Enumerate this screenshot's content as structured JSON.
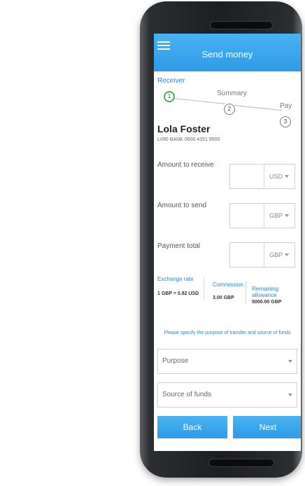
{
  "header": {
    "title": "Send money"
  },
  "steps": [
    {
      "label": "Receiver",
      "number": "1"
    },
    {
      "label": "Summary",
      "number": "2"
    },
    {
      "label": "Pay",
      "number": "3"
    }
  ],
  "receiver": {
    "name": "Lola Foster",
    "account": "LV80 BANK 0000 4351 9500"
  },
  "fields": [
    {
      "label": "Amount to receive",
      "value": "",
      "currency": "USD"
    },
    {
      "label": "Amount to send",
      "value": "",
      "currency": "GBP"
    },
    {
      "label": "Payment total",
      "value": "",
      "currency": "GBP"
    }
  ],
  "stats": {
    "exchange_rate": {
      "label": "Exchange rate",
      "value": "1 GBP = 0.82 USD"
    },
    "commission": {
      "label": "Commission",
      "value": "3.00 GBP"
    },
    "allowance": {
      "label": "Remaining allowance",
      "value": "5000.00 GBP"
    }
  },
  "purpose_hint": "Please specify the purpose of transfer and source of funds",
  "selects": {
    "purpose": "Purpose",
    "source": "Source of funds"
  },
  "buttons": {
    "back": "Back",
    "next": "Next"
  },
  "colors": {
    "accent": "#2f9ae6",
    "step_active": "#4caf50"
  }
}
